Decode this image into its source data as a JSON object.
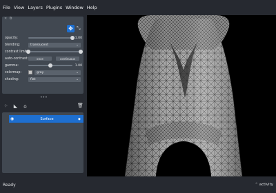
{
  "menu": [
    "File",
    "View",
    "Layers",
    "Plugins",
    "Window",
    "Help"
  ],
  "layer_controls": {
    "opacity": {
      "label": "opacity:",
      "value": "1.00",
      "level": 1.0
    },
    "blending": {
      "label": "blending:",
      "value": "translucent"
    },
    "contrast_limits": {
      "label": "contrast limits:",
      "low": 0.0,
      "high": 1.0
    },
    "auto_contrast": {
      "label": "auto-contrast:",
      "once": "once",
      "continuous": "continuous"
    },
    "gamma": {
      "label": "gamma:",
      "value": "1.00",
      "level": 0.5
    },
    "colormap": {
      "label": "colormap:",
      "value": "gray"
    },
    "shading": {
      "label": "shading:",
      "value": "flat"
    }
  },
  "layers": [
    {
      "name": "Surface",
      "selected": true
    }
  ],
  "status": {
    "text": "Ready",
    "activity": "activity"
  },
  "colors": {
    "accent": "#1e6fd0",
    "panel": "#414851",
    "background": "#262930",
    "canvas": "#000000"
  }
}
